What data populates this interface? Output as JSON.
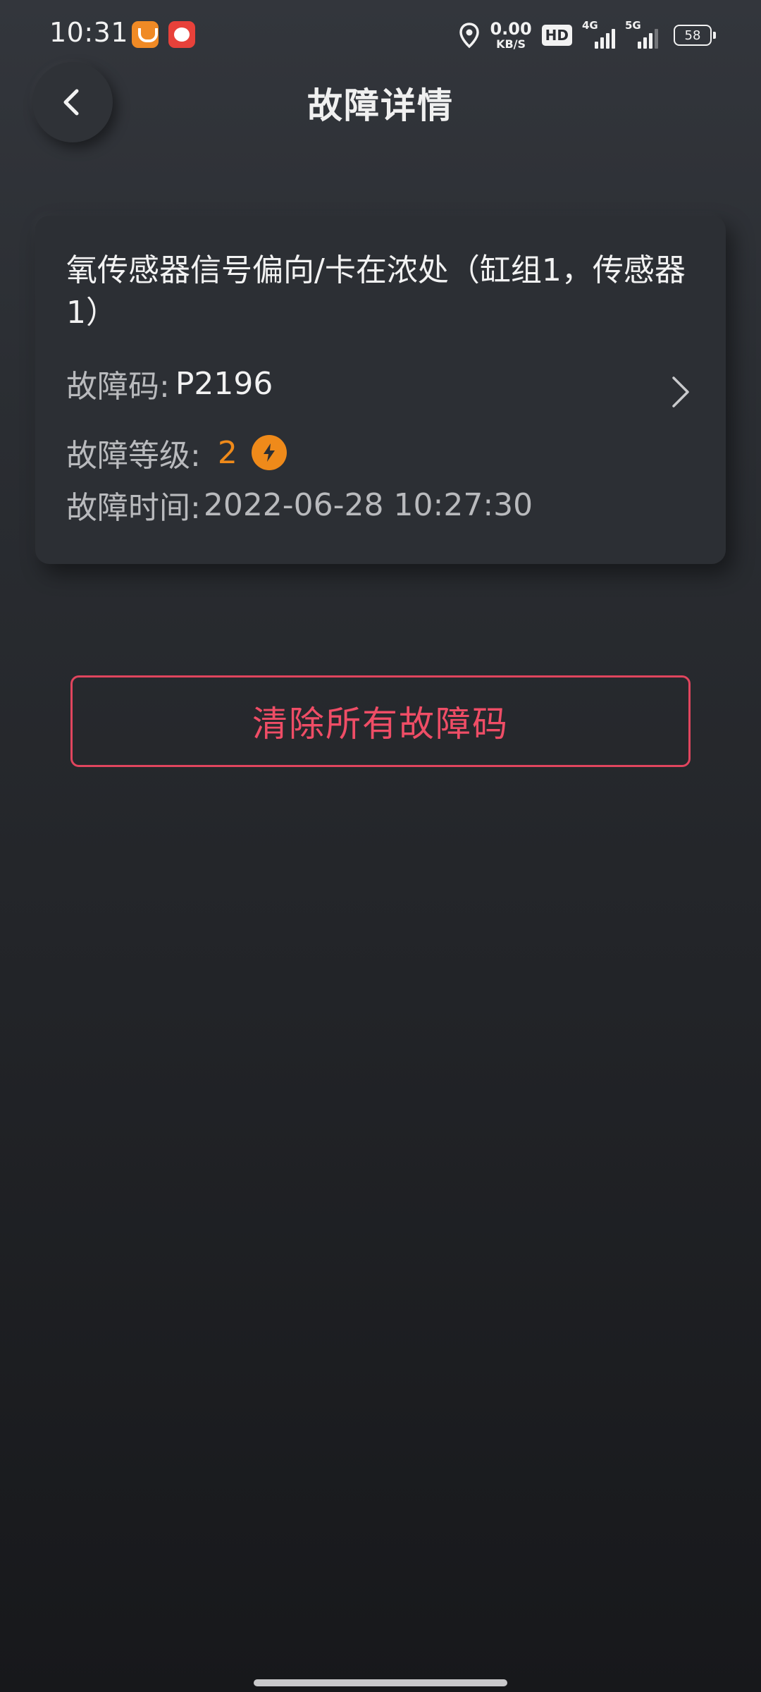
{
  "status_bar": {
    "time": "10:31",
    "net_speed_value": "0.00",
    "net_speed_unit": "KB/S",
    "hd_label": "HD",
    "signal_1_label": "4G",
    "signal_2_label": "5G",
    "battery": "58"
  },
  "header": {
    "title": "故障详情"
  },
  "fault": {
    "name": "氧传感器信号偏向/卡在浓处（缸组1，传感器1）",
    "code_label": "故障码:",
    "code_value": "P2196",
    "level_label": "故障等级:",
    "level_value": "2",
    "time_label": "故障时间:",
    "time_value": "2022-06-28 10:27:30",
    "level_color": "#ef8a1a"
  },
  "actions": {
    "clear_all_label": "清除所有故障码",
    "clear_color": "#e0455e"
  },
  "icons": {
    "back": "back-arrow-icon",
    "chevron": "chevron-right-icon",
    "level": "lightning-bolt-icon",
    "location": "location-pin-icon"
  }
}
